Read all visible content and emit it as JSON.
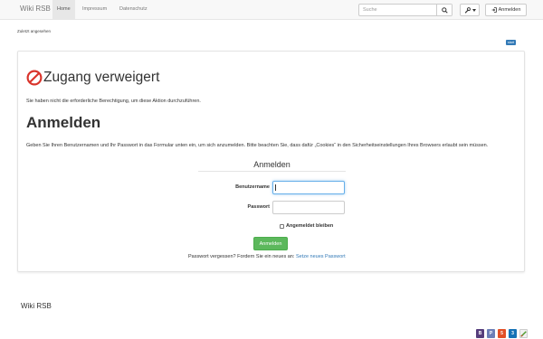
{
  "navbar": {
    "brand": "Wiki RSB",
    "links": [
      {
        "label": "Home"
      },
      {
        "label": "Impressum"
      },
      {
        "label": "Datenschutz"
      }
    ],
    "search": {
      "placeholder": "Suche",
      "value": ""
    },
    "login_label": "Anmelden"
  },
  "recent_label": "Zuletzt angesehen",
  "start_badge": "start",
  "denied": {
    "heading": "Zugang verweigert",
    "text": "Sie haben nicht die erforderliche Berechtigung, um diese Aktion durchzuführen."
  },
  "login": {
    "heading": "Anmelden",
    "text": "Geben Sie Ihren Benutzernamen und Ihr Passwort in das Formular unten ein, um sich anzumelden. Bitte beachten Sie, dass dafür „Cookies“ in den Sicherheitseinstellungen Ihres Browsers erlaubt sein müssen.",
    "form": {
      "legend": "Anmelden",
      "username_label": "Benutzername",
      "username_value": "",
      "password_label": "Passwort",
      "password_value": "",
      "remember_label": "Angemeldet bleiben",
      "remember_checked": false,
      "submit_label": "Anmelden"
    },
    "forgot_text": "Passwort vergessen? Fordern Sie ein neues an:",
    "forgot_link": "Setze neues Passwort"
  },
  "footer": {
    "title": "Wiki RSB",
    "icons": [
      "bootstrap-icon",
      "php-icon",
      "html5-icon",
      "css3-icon",
      "dokuwiki-icon"
    ]
  },
  "colors": {
    "accent": "#337ab7",
    "success": "#5cb85c",
    "denied_red": "#d9342b"
  }
}
